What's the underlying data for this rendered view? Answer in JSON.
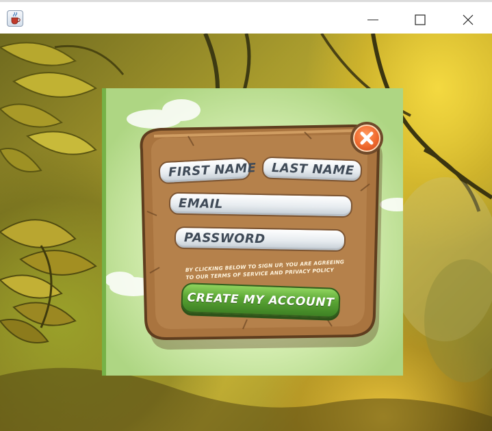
{
  "window": {
    "app_icon": "java-cup-icon",
    "controls": [
      "minimize-icon",
      "maximize-icon",
      "close-icon"
    ]
  },
  "form": {
    "first_name_placeholder": "FIRST NAME",
    "last_name_placeholder": "LAST NAME",
    "email_placeholder": "EMAIL",
    "password_placeholder": "PASSWORD",
    "terms_line_1": "BY CLICKING BELOW TO SIGN UP, YOU ARE AGREEING",
    "terms_line_2": "TO OUR TERMS OF SERVICE AND PRIVACY POLICY",
    "create_button_label": "CREATE MY ACCOUNT",
    "close_icon": "close-x-icon"
  },
  "colors": {
    "panel_wood": "#a9743f",
    "button_green": "#5aa534",
    "close_orange": "#f06a2e",
    "panel_bg": "#d6eeb2"
  }
}
